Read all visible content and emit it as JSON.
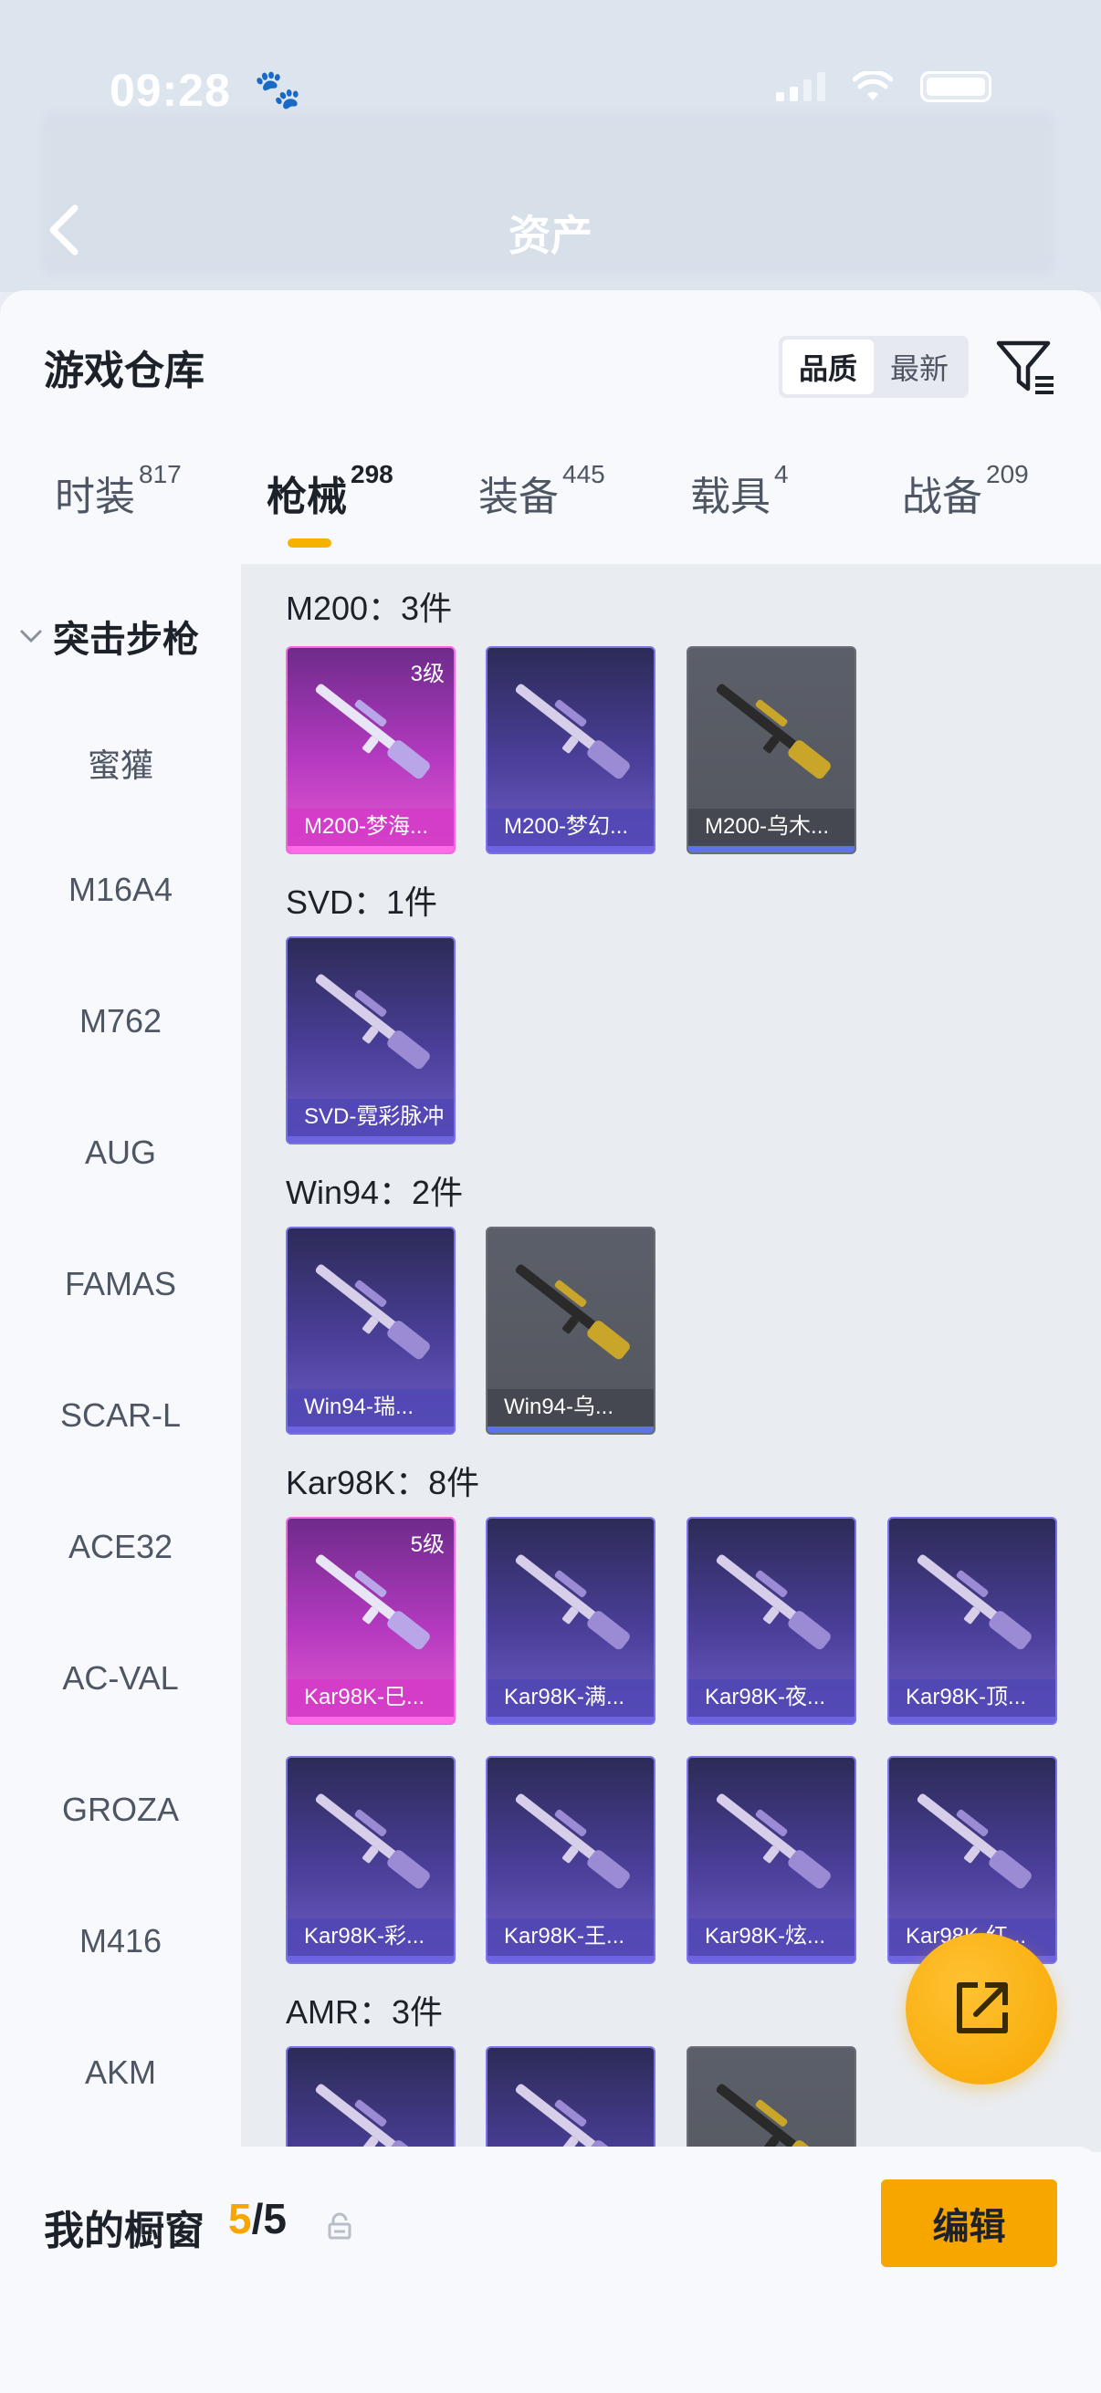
{
  "status_bar": {
    "time": "09:28"
  },
  "header": {
    "title": "资产"
  },
  "warehouse": {
    "title": "游戏仓库",
    "sort": {
      "quality": "品质",
      "newest": "最新",
      "active": "quality"
    }
  },
  "tabs": [
    {
      "label": "时装",
      "count": "817"
    },
    {
      "label": "枪械",
      "count": "298"
    },
    {
      "label": "装备",
      "count": "445"
    },
    {
      "label": "载具",
      "count": "4"
    },
    {
      "label": "战备",
      "count": "209"
    }
  ],
  "sidebar": {
    "category": "突击步枪",
    "items": [
      "蜜獾",
      "M16A4",
      "M762",
      "AUG",
      "FAMAS",
      "SCAR-L",
      "ACE32",
      "AC-VAL",
      "GROZA",
      "M416",
      "AKM"
    ]
  },
  "groups": [
    {
      "title": "M200：3件",
      "items": [
        {
          "name": "M200-梦海...",
          "rarity": "pink",
          "level": "3级"
        },
        {
          "name": "M200-梦幻...",
          "rarity": "purple",
          "level": ""
        },
        {
          "name": "M200-乌木...",
          "rarity": "gray",
          "level": ""
        }
      ]
    },
    {
      "title": "SVD：1件",
      "items": [
        {
          "name": "SVD-霓彩脉冲",
          "rarity": "purple",
          "level": ""
        }
      ]
    },
    {
      "title": "Win94：2件",
      "items": [
        {
          "name": "Win94-瑞...",
          "rarity": "purple",
          "level": ""
        },
        {
          "name": "Win94-乌...",
          "rarity": "gray",
          "level": ""
        }
      ]
    },
    {
      "title": "Kar98K：8件",
      "items": [
        {
          "name": "Kar98K-巳...",
          "rarity": "pink",
          "level": "5级"
        },
        {
          "name": "Kar98K-满...",
          "rarity": "purple",
          "level": ""
        },
        {
          "name": "Kar98K-夜...",
          "rarity": "purple",
          "level": ""
        },
        {
          "name": "Kar98K-顶...",
          "rarity": "purple",
          "level": ""
        },
        {
          "name": "Kar98K-彩...",
          "rarity": "purple",
          "level": ""
        },
        {
          "name": "Kar98K-王...",
          "rarity": "purple",
          "level": ""
        },
        {
          "name": "Kar98K-炫...",
          "rarity": "purple",
          "level": ""
        },
        {
          "name": "Kar98K-红...",
          "rarity": "purple",
          "level": ""
        }
      ]
    },
    {
      "title": "AMR：3件",
      "items": [
        {
          "name": "",
          "rarity": "purple",
          "level": ""
        },
        {
          "name": "",
          "rarity": "purple",
          "level": ""
        },
        {
          "name": "",
          "rarity": "gray",
          "level": ""
        }
      ]
    }
  ],
  "showcase": {
    "title": "我的橱窗",
    "current": "5",
    "total": "/5",
    "edit_label": "编辑"
  },
  "colors": {
    "accent": "#f7a600",
    "purple_rarity": "#6e63e0",
    "pink_rarity": "#e65bd0",
    "gray_rarity": "#5e73e6"
  }
}
